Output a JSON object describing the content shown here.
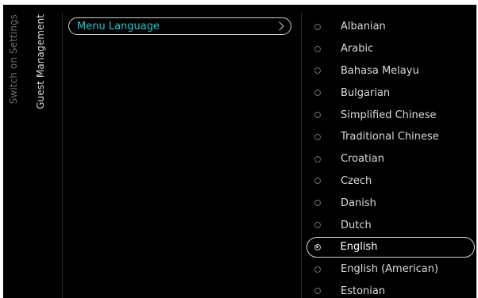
{
  "sidebar": {
    "items": [
      {
        "label": "Switch on Settings"
      },
      {
        "label": "Guest Management"
      }
    ]
  },
  "menu": {
    "item_label": "Menu Language",
    "chevron_icon": "chevron-right-icon"
  },
  "colors": {
    "accent": "#26c2cc",
    "background": "#000000",
    "text": "#d9d9d9",
    "dim_text": "#6e6e6e"
  },
  "languages": [
    {
      "label": "Albanian",
      "selected": false
    },
    {
      "label": "Arabic",
      "selected": false
    },
    {
      "label": "Bahasa Melayu",
      "selected": false
    },
    {
      "label": "Bulgarian",
      "selected": false
    },
    {
      "label": "Simplified Chinese",
      "selected": false
    },
    {
      "label": "Traditional Chinese",
      "selected": false
    },
    {
      "label": "Croatian",
      "selected": false
    },
    {
      "label": "Czech",
      "selected": false
    },
    {
      "label": "Danish",
      "selected": false
    },
    {
      "label": "Dutch",
      "selected": false
    },
    {
      "label": "English",
      "selected": true
    },
    {
      "label": "English (American)",
      "selected": false
    },
    {
      "label": "Estonian",
      "selected": false
    }
  ]
}
